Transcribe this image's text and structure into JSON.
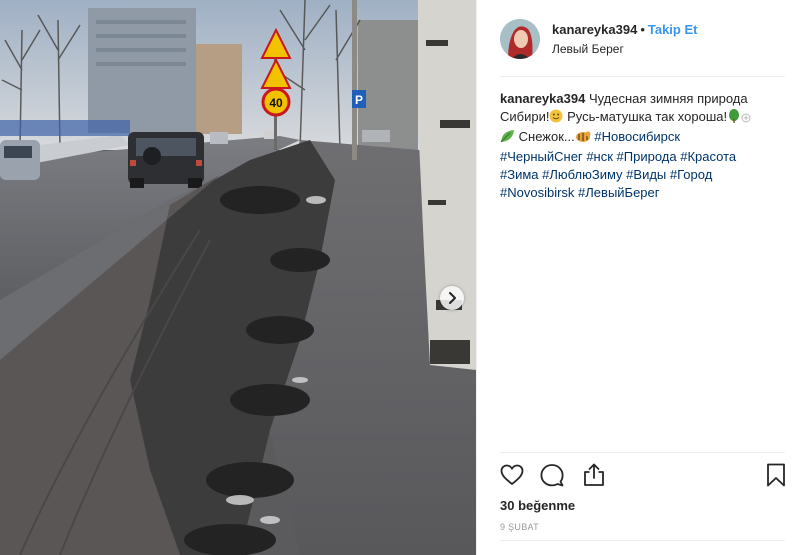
{
  "post": {
    "username": "kanareyka394",
    "separator": "•",
    "follow_label": "Takip Et",
    "location": "Левый Берег",
    "caption": {
      "username": "kanareyka394",
      "line1": "Чудесная зимняя природа Сибири!",
      "line2": "Русь-матушка так хороша!",
      "line3": "Снежок...",
      "tags": [
        "#Новосибирск",
        "#ЧерныйСнег",
        "#нск",
        "#Природа",
        "#Красота",
        "#Зима",
        "#ЛюблюЗиму",
        "#Виды",
        "#Город",
        "#Novosibirsk",
        "#ЛевыйБерег"
      ]
    },
    "likes": "30 beğenme",
    "date": "9 Şubat"
  },
  "photo": {
    "speed_sign": "40",
    "parking_sign": "P"
  },
  "icons": {
    "like": "heart-icon",
    "comment": "comment-icon",
    "share": "share-icon",
    "save": "bookmark-icon",
    "next": "chevron-right-icon"
  },
  "colors": {
    "link": "#3897f0",
    "hashtag": "#003569",
    "text": "#262626",
    "muted": "#999999"
  }
}
